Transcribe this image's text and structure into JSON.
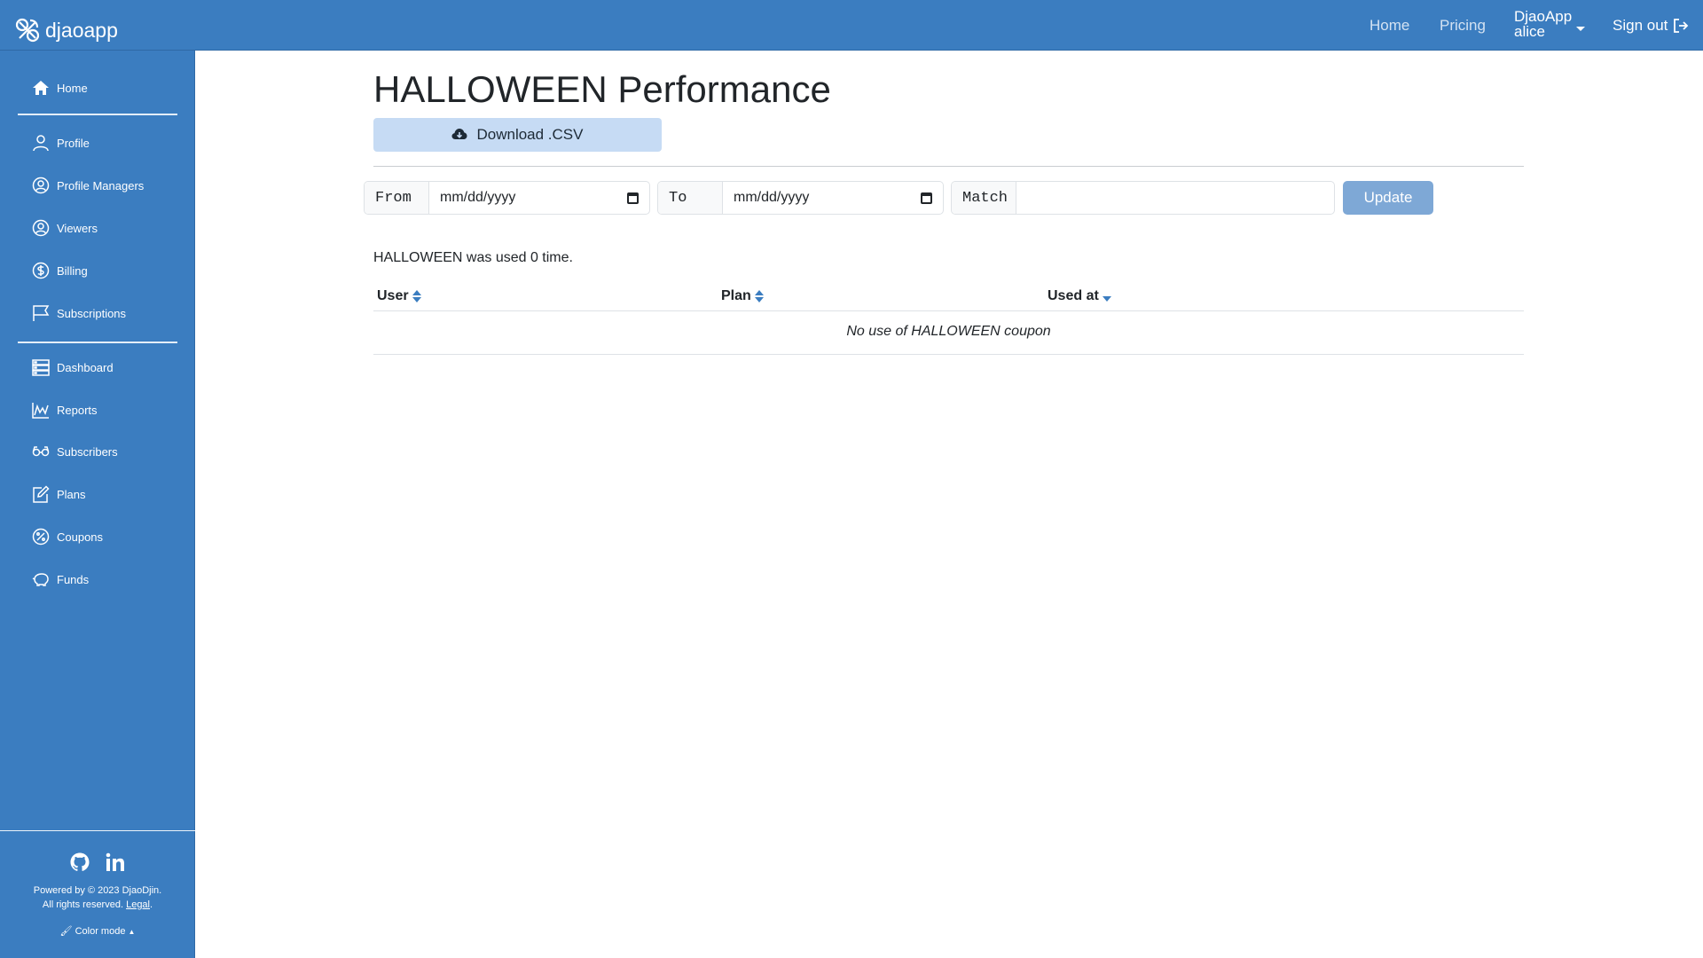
{
  "brand": {
    "name": "djaoapp"
  },
  "topnav": {
    "home": "Home",
    "pricing": "Pricing",
    "account_org": "DjaoApp",
    "account_user": "alice",
    "signout": "Sign out"
  },
  "sidebar": {
    "items": [
      {
        "label": "Home",
        "icon": "home-icon"
      },
      {
        "label": "Profile",
        "icon": "person-icon"
      },
      {
        "label": "Profile Managers",
        "icon": "person-circle-icon"
      },
      {
        "label": "Viewers",
        "icon": "person-circle-icon"
      },
      {
        "label": "Billing",
        "icon": "dollar-circle-icon"
      },
      {
        "label": "Subscriptions",
        "icon": "flag-icon"
      },
      {
        "label": "Dashboard",
        "icon": "dashboard-icon"
      },
      {
        "label": "Reports",
        "icon": "chart-icon"
      },
      {
        "label": "Subscribers",
        "icon": "glasses-icon"
      },
      {
        "label": "Plans",
        "icon": "edit-icon"
      },
      {
        "label": "Coupons",
        "icon": "percent-icon"
      },
      {
        "label": "Funds",
        "icon": "piggy-bank-icon"
      }
    ],
    "footer": {
      "powered": "Powered by © 2023 DjaoDjin.",
      "rights": "All rights reserved.",
      "legal": "Legal",
      "color_mode": "Color mode"
    }
  },
  "main": {
    "title": "HALLOWEEN Performance",
    "download_label": "Download .CSV",
    "filters": {
      "from_label": "From",
      "from_placeholder": "mm/dd/yyyy",
      "to_label": "To",
      "to_placeholder": "mm/dd/yyyy",
      "match_label": "Match",
      "match_value": "",
      "update_label": "Update"
    },
    "usage_text": "HALLOWEEN was used 0 time.",
    "table": {
      "columns": [
        "User",
        "Plan",
        "Used at"
      ],
      "empty_message": "No use of HALLOWEEN coupon"
    }
  },
  "colors": {
    "brand_blue": "#3b7dc0",
    "button_light": "#c6dbf4",
    "update_btn": "#7ea8d6"
  }
}
